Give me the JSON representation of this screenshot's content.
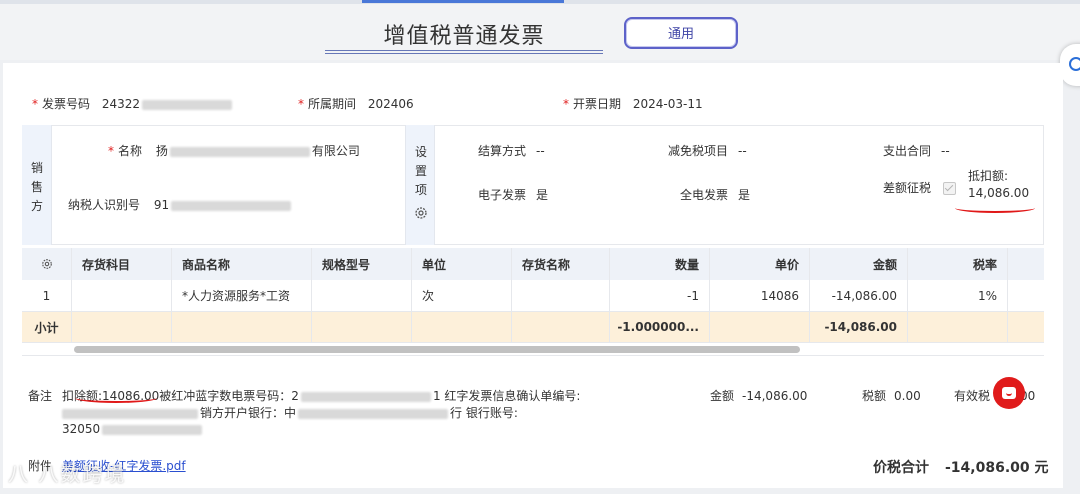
{
  "header": {
    "title": "增值税普通发票",
    "invoice_type_button": "通用"
  },
  "invoice": {
    "invoice_no_label": "发票号码",
    "invoice_no_value": "24322",
    "period_label": "所属期间",
    "period_value": "202406",
    "issue_date_label": "开票日期",
    "issue_date_value": "2024-03-11"
  },
  "seller": {
    "section_label": [
      "销",
      "售",
      "方"
    ],
    "name_label": "名称",
    "name_value_tail": "有限公司",
    "taxid_label": "纳税人识别号",
    "taxid_value_head": "91"
  },
  "settings": {
    "section_label": [
      "设",
      "置",
      "项"
    ],
    "settlement_label": "结算方式",
    "settlement_value": "--",
    "tax_relief_label": "减免税项目",
    "tax_relief_value": "--",
    "expense_contract_label": "支出合同",
    "expense_contract_value": "--",
    "e_invoice_label": "电子发票",
    "e_invoice_value": "是",
    "full_e_invoice_label": "全电发票",
    "full_e_invoice_value": "是",
    "diff_tax_label": "差额征税",
    "deduction_label": "抵扣额:",
    "deduction_value": "14,086.00"
  },
  "table": {
    "headers": [
      "存货科目",
      "商品名称",
      "规格型号",
      "单位",
      "存货名称",
      "数量",
      "单价",
      "金额",
      "税率"
    ],
    "rows": [
      {
        "index": "1",
        "account": "",
        "product": "*人力资源服务*工资",
        "spec": "",
        "unit": "次",
        "inventory": "",
        "qty": "-1",
        "price": "14086",
        "amount": "-14,086.00",
        "rate": "1%"
      }
    ],
    "subtotal": {
      "label": "小计",
      "qty": "-1.000000...",
      "amount": "-14,086.00"
    }
  },
  "footer": {
    "remark_label": "备注",
    "remark_line1": "扣除额:14086.00被红冲蓝字数电票号码：2",
    "remark_line1_tail": "1 红字发票信息确认单编号:",
    "remark_line2": "销方开户银行：中",
    "remark_line2_tail": "行 银行账号:",
    "remark_line3": "32050",
    "amount_label": "金额",
    "amount_value": "-14,086.00",
    "tax_label": "税额",
    "tax_value": "0.00",
    "effective_tax_label": "有效税",
    "effective_tax_tail": "00",
    "attachment_label": "附件",
    "attachment_file": "差额征收-红字发票.pdf",
    "total_label": "价税合计",
    "total_value": "-14,086.00 元"
  },
  "watermark": "八 八数跨境"
}
